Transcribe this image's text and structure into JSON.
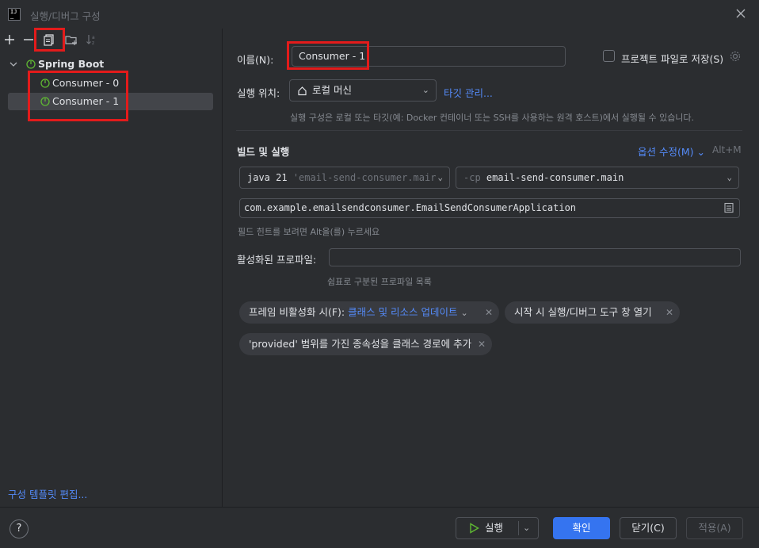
{
  "window": {
    "title": "실행/디버그 구성"
  },
  "tree": {
    "root": "Spring Boot",
    "items": [
      {
        "label": "Consumer - 0"
      },
      {
        "label": "Consumer - 1"
      }
    ],
    "edit_templates": "구성 템플릿 편집..."
  },
  "form": {
    "name_label": "이름(N):",
    "name_value": "Consumer - 1",
    "store_checkbox": "프로젝트 파일로 저장(S)",
    "run_on_label": "실행 위치:",
    "run_on_value": "로컬 머신",
    "manage_targets": "타깃 관리...",
    "run_on_hint": "실행 구성은 로컬 또는 타깃(예: Docker 컨테이너 또는 SSH를 사용하는 원격 호스트)에서 실행될 수 있습니다.",
    "build_run_title": "빌드 및 실행",
    "modify_options": "옵션 수정(M)",
    "modify_shortcut": "Alt+M",
    "jdk_prefix": "java 21",
    "jdk_module": "'email-send-consumer.mair",
    "cp_prefix": "-cp",
    "cp_value": "email-send-consumer.main",
    "main_class": "com.example.emailsendconsumer.EmailSendConsumerApplication",
    "field_hint": "필드 힌트를 보려면 Alt을(를) 누르세요",
    "profiles_label": "활성화된 프로파일:",
    "profiles_value": "",
    "profiles_hint": "쉼표로 구분된 프로파일 목록",
    "chip1_prefix": "프레임 비활성화 시(F):",
    "chip1_value": "클래스 및 리소스 업데이트",
    "chip2": "시작 시 실행/디버그 도구 창 열기",
    "chip3": "'provided' 범위를 가진 종속성을 클래스 경로에 추가"
  },
  "footer": {
    "help": "?",
    "run": "실행",
    "ok": "확인",
    "close": "닫기(C)",
    "apply": "적용(A)"
  },
  "colors": {
    "accent": "#3574f0",
    "link": "#548af7",
    "highlight": "#e31b1b",
    "spring": "#5fb832"
  }
}
